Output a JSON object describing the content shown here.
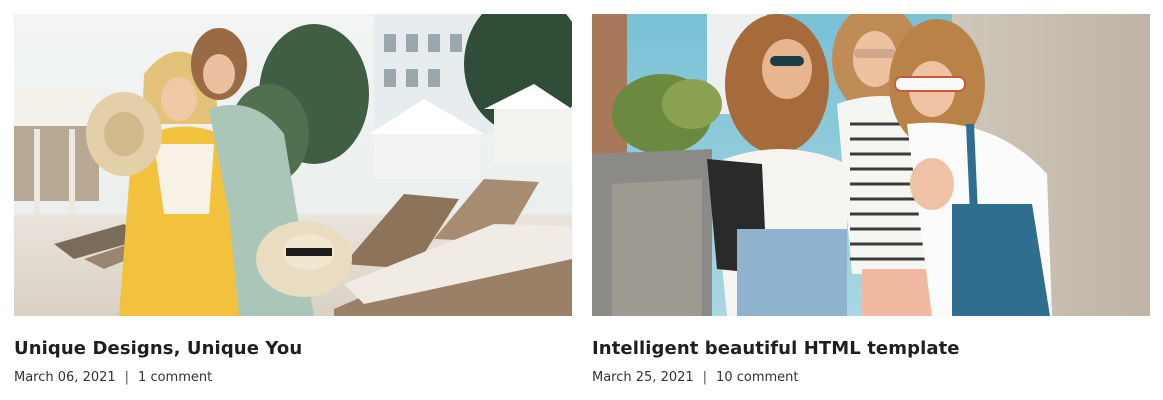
{
  "posts": [
    {
      "title": "Unique Designs, Unique You",
      "date": "March 06, 2021",
      "separator": "|",
      "comments": "1 comment",
      "image_icon": "photo-two-women-poolside"
    },
    {
      "title": "Intelligent beautiful HTML template",
      "date": "March 25, 2021",
      "separator": "|",
      "comments": "10 comment",
      "image_icon": "photo-three-women-street"
    }
  ],
  "colors": {
    "title": "#1f1f1f",
    "meta": "#333333",
    "background": "#ffffff"
  }
}
